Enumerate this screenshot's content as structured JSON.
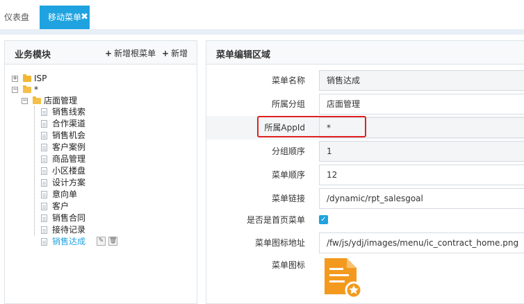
{
  "tabs": [
    {
      "label": "仪表盘"
    },
    {
      "label": "移动菜单",
      "close": "✖"
    }
  ],
  "left_panel": {
    "title": "业务模块",
    "add_root_label": "新增根菜单",
    "add_label": "新增"
  },
  "tree": {
    "isp": "ISP",
    "star": "*",
    "store": "店面管理",
    "items": [
      "销售线索",
      "合作渠道",
      "销售机会",
      "客户案例",
      "商品管理",
      "小区楼盘",
      "设计方案",
      "意向单",
      "客户",
      "销售合同",
      "接待记录",
      "销售达成"
    ]
  },
  "right_panel": {
    "title": "菜单编辑区域"
  },
  "form": {
    "menu_name_label": "菜单名称",
    "menu_name": "销售达成",
    "group_label": "所属分组",
    "group": "店面管理",
    "appid_label": "所属AppId",
    "appid": "*",
    "group_order_label": "分组顺序",
    "group_order": "1",
    "menu_order_label": "菜单顺序",
    "menu_order": "12",
    "link_label": "菜单链接",
    "link": "/dynamic/rpt_salesgoal",
    "homepage_label": "是否是首页菜单",
    "homepage_checked": true,
    "icon_url_label": "菜单图标地址",
    "icon_url": "/fw/js/ydj/images/menu/ic_contract_home.png",
    "icon_label": "菜单图标"
  },
  "colors": {
    "accent": "#1ea3e0",
    "highlight_box": "#e02020",
    "icon_orange": "#f39a1e"
  }
}
